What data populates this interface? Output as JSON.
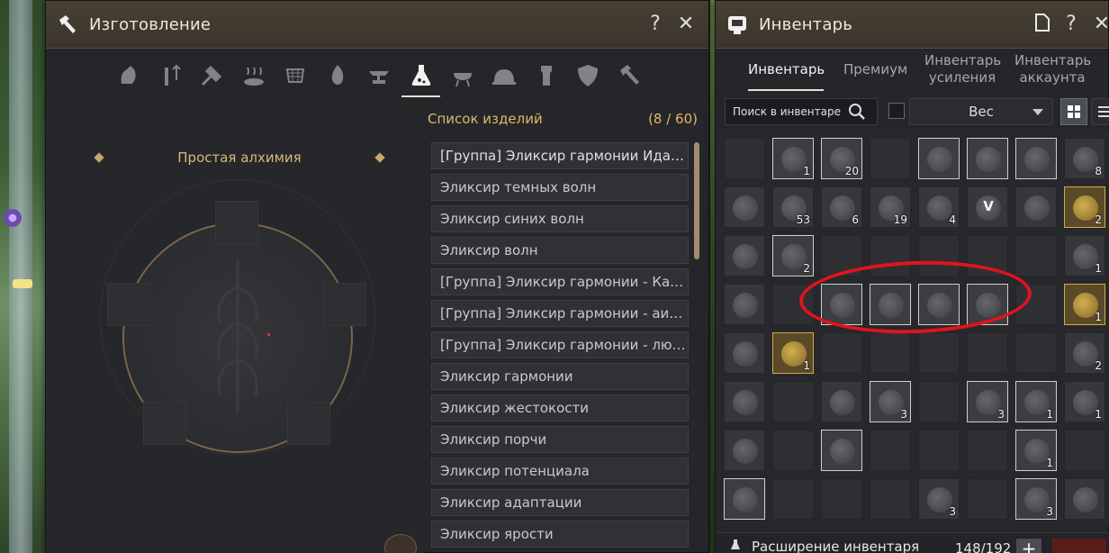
{
  "crafting": {
    "title": "Изготовление",
    "help_label": "?",
    "close_label": "✕",
    "category_icons": [
      "grinding-icon",
      "heating-icon",
      "chopping-icon",
      "cooking-icon",
      "drying-icon",
      "fire-icon",
      "anvil-icon",
      "alchemy-flask-icon",
      "grill-icon",
      "cloche-icon",
      "tower-icon",
      "shield-icon",
      "hammer-icon"
    ],
    "active_category": "alchemy-flask-icon",
    "recipe_name": "Простая алхимия",
    "list_title": "Список изделий",
    "list_count": "(8 / 60)",
    "items": [
      "[Группа] Эликсир гармонии Идании",
      "Эликсир темных волн",
      "Эликсир синих волн",
      "Эликсир волн",
      "[Группа] Эликсир гармонии - Кама...",
      "[Группа] Эликсир гармонии - аины",
      "[Группа] Эликсир гармонии - люди",
      "Эликсир гармонии",
      "Эликсир жестокости",
      "Эликсир порчи",
      "Эликсир потенциала",
      "Эликсир адаптации",
      "Эликсир ярости"
    ]
  },
  "inventory": {
    "title": "Инвентарь",
    "help_label": "?",
    "close_label": "✕",
    "tabs": [
      "Инвентарь",
      "Премиум",
      "Инвентарь усиления",
      "Инвентарь аккаунта"
    ],
    "active_tab": "Инвентарь",
    "search_placeholder": "Поиск в инвентаре",
    "sort_value": "Вес",
    "expand_label": "Расширение инвентаря",
    "capacity": "148/192",
    "plus_label": "+",
    "grid": [
      [
        "empty",
        "item:1",
        "item:20",
        "empty",
        "item:",
        "item:",
        "item:",
        "dim:8"
      ],
      [
        "dim:",
        "dim:53",
        "dim:6",
        "dim:19",
        "dim:4",
        "dim:V",
        "dim:",
        "gold:2"
      ],
      [
        "dim:",
        "item:2",
        "empty",
        "empty",
        "empty",
        "empty",
        "empty",
        "dim:1"
      ],
      [
        "dim:",
        "empty",
        "item:",
        "item:",
        "item:",
        "item:",
        "empty",
        "gold:1"
      ],
      [
        "dim:",
        "gold:1",
        "empty",
        "empty",
        "empty",
        "empty",
        "empty",
        "dim:2"
      ],
      [
        "dim:",
        "empty",
        "dim:",
        "item:3",
        "empty",
        "item:3",
        "item:1",
        "dim:1"
      ],
      [
        "dim:",
        "empty",
        "item:",
        "empty",
        "empty",
        "empty",
        "item:1",
        "empty"
      ],
      [
        "item:",
        "empty",
        "empty",
        "empty",
        "dim:3",
        "empty",
        "item:3",
        "dim:"
      ]
    ]
  }
}
